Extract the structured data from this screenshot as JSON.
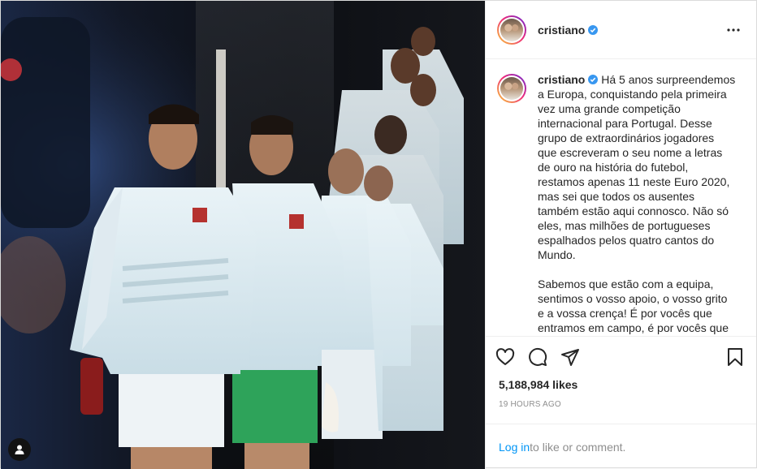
{
  "post": {
    "username": "cristiano",
    "verified": true,
    "caption": "Há 5 anos surpreendemos a Europa, conquistando pela primeira vez uma grande competição internacional para Portugal. Desse grupo de extraordinários jogadores que escreveram o seu nome a letras de ouro na história do futebol, restamos apenas 11 neste Euro 2020, mas sei que todos os ausentes também estão aqui connosco. Não só eles, mas milhões de portugueses espalhados pelos quatro cantos do Mundo.\n\nSabemos que estão com a equipa, sentimos o vosso apoio, o vosso grito e a vossa crença! É por vocês que entramos em campo, é por vocês que vamos continuar a lutar!",
    "likes": "5,188,984 likes",
    "time": "19 hours ago"
  },
  "icons": {
    "more": "more-options-icon",
    "like": "heart-icon",
    "comment": "comment-icon",
    "share": "share-icon",
    "save": "bookmark-icon",
    "user_tag": "user-tag-icon",
    "verified": "verified-badge-icon"
  },
  "footer": {
    "login_link": "Log in",
    "login_rest": " to like or comment."
  },
  "colors": {
    "link": "#0095f6",
    "verified": "#3897f0",
    "muted": "#8e8e8e",
    "text": "#262626"
  }
}
